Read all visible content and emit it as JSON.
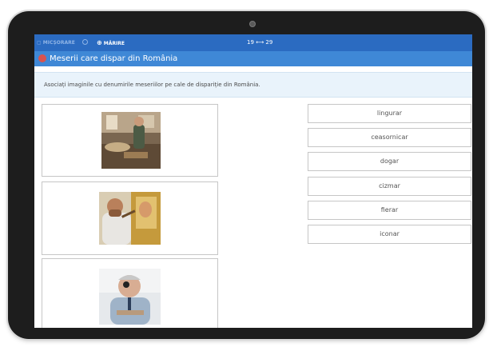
{
  "topbar": {
    "shrink_label": "MICȘORARE",
    "zoom_label": "MĂRIRE",
    "pages": "19 ⟷ 29"
  },
  "title": "Meserii care dispar din România",
  "instruction": "Asociați imaginile cu denumirile meseriilor pe cale de dispariție din România.",
  "images": [
    {
      "icon": "woodworker-photo"
    },
    {
      "icon": "icon-painter-photo"
    },
    {
      "icon": "watchmaker-photo"
    }
  ],
  "words": [
    "lingurar",
    "ceasornicar",
    "dogar",
    "cizmar",
    "fierar",
    "iconar"
  ],
  "colors": {
    "topbar": "#2b6bc1",
    "titlebar": "#3f88d6",
    "instruction_bg": "#e9f3fb",
    "title_icon": "#d9534f"
  }
}
